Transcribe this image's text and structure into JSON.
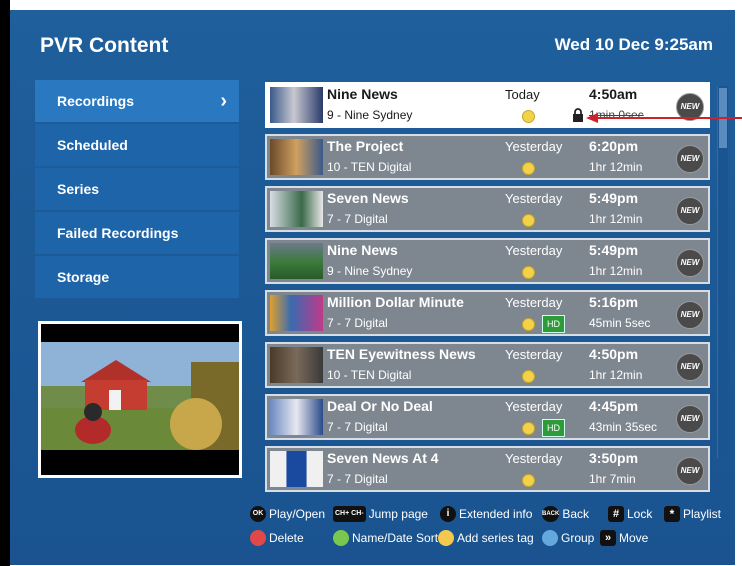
{
  "header": {
    "title": "PVR Content",
    "date": "Wed 10 Dec 9:25am"
  },
  "menu": [
    {
      "label": "Recordings",
      "chevron": "›"
    },
    {
      "label": "Scheduled"
    },
    {
      "label": "Series"
    },
    {
      "label": "Failed Recordings"
    },
    {
      "label": "Storage"
    }
  ],
  "recordings": [
    {
      "title": "Nine News",
      "channel": "9 - Nine Sydney",
      "day": "Today",
      "time": "4:50am",
      "duration": "1min 0sec",
      "hd": false,
      "new": "NEW"
    },
    {
      "title": "The Project",
      "channel": "10 - TEN Digital",
      "day": "Yesterday",
      "time": "6:20pm",
      "duration": "1hr 12min",
      "hd": false,
      "new": "NEW"
    },
    {
      "title": "Seven News",
      "channel": "7 - 7 Digital",
      "day": "Yesterday",
      "time": "5:49pm",
      "duration": "1hr 12min",
      "hd": false,
      "new": "NEW"
    },
    {
      "title": "Nine News",
      "channel": "9 - Nine Sydney",
      "day": "Yesterday",
      "time": "5:49pm",
      "duration": "1hr 12min",
      "hd": false,
      "new": "NEW"
    },
    {
      "title": "Million Dollar Minute",
      "channel": "7 - 7 Digital",
      "day": "Yesterday",
      "time": "5:16pm",
      "duration": "45min 5sec",
      "hd": true,
      "new": "NEW"
    },
    {
      "title": "TEN Eyewitness News",
      "channel": "10 - TEN Digital",
      "day": "Yesterday",
      "time": "4:50pm",
      "duration": "1hr 12min",
      "hd": false,
      "new": "NEW"
    },
    {
      "title": "Deal Or No Deal",
      "channel": "7 - 7 Digital",
      "day": "Yesterday",
      "time": "4:45pm",
      "duration": "43min 35sec",
      "hd": true,
      "new": "NEW"
    },
    {
      "title": "Seven News At 4",
      "channel": "7 - 7 Digital",
      "day": "Yesterday",
      "time": "3:50pm",
      "duration": "1hr 7min",
      "hd": false,
      "new": "NEW"
    }
  ],
  "legend": {
    "play": {
      "key": "OK",
      "label": "Play/Open"
    },
    "jump": {
      "key": "CH+ CH-",
      "label": "Jump page"
    },
    "info": {
      "key": "i",
      "label": "Extended info"
    },
    "back": {
      "key": "BACK",
      "label": "Back"
    },
    "lock": {
      "key": "#",
      "label": "Lock"
    },
    "playlist": {
      "key": "*",
      "label": "Playlist"
    },
    "delete": {
      "label": "Delete"
    },
    "sort": {
      "label": "Name/Date Sort"
    },
    "series": {
      "label": "Add series tag"
    },
    "group": {
      "label": "Group"
    },
    "move": {
      "key": "»",
      "label": "Move"
    }
  },
  "colors": {
    "background": "#1c5a96",
    "menu_active": "#2a78bf",
    "row": "#7e8790",
    "row_selected": "#ffffff",
    "red_key": "#e0484a",
    "green_key": "#79c74f",
    "yellow_key": "#f2c94c",
    "blue_key": "#64a8de",
    "annotation_arrow": "#d0202a"
  },
  "icons": {
    "lock": "lock-icon",
    "new_badge": "new-badge-icon",
    "coin": "series-coin-icon",
    "hd": "hd-icon"
  }
}
